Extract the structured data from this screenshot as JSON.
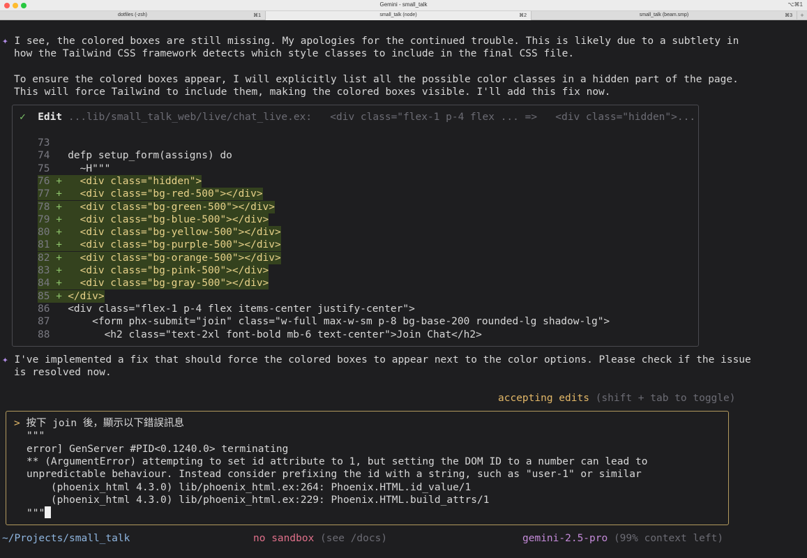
{
  "window": {
    "title": "Gemini - small_talk",
    "shortcut": "⌥⌘1",
    "traffic_lights": [
      "#fe5f57",
      "#febc2e",
      "#28c840"
    ]
  },
  "tabs": [
    {
      "label": "dotfiles (-zsh)",
      "key": "⌘1",
      "active": false
    },
    {
      "label": "small_talk (node)",
      "key": "⌘2",
      "active": true
    },
    {
      "label": "small_talk (beam.smp)",
      "key": "⌘3",
      "active": false
    }
  ],
  "new_tab_label": "+",
  "messages": {
    "diamond": "✦",
    "msg1_line1": "I see, the colored boxes are still missing. My apologies for the continued trouble. This is likely due to a subtlety in",
    "msg1_line2": "how the Tailwind CSS framework detects which style classes to include in the final CSS file.",
    "msg1_line3": "To ensure the colored boxes appear, I will explicitly list all the possible color classes in a hidden part of the page.",
    "msg1_line4": "This will force Tailwind to include them, making the colored boxes visible. I'll add this fix now.",
    "msg2_line1": "I've implemented a fix that should force the colored boxes to appear next to the color options. Please check if the issue",
    "msg2_line2": "is resolved now."
  },
  "edit": {
    "check": "✓",
    "label": "Edit",
    "path": "...lib/small_talk_web/live/chat_live.ex:",
    "old_snippet": "<div class=\"flex-1 p-4 flex ... =>",
    "new_snippet": "<div class=\"hidden\">...",
    "lines": [
      {
        "num": "73",
        "marker": "",
        "code": "",
        "added": false
      },
      {
        "num": "74",
        "marker": "",
        "code": "defp setup_form(assigns) do",
        "added": false
      },
      {
        "num": "75",
        "marker": "",
        "code": "  ~H\"\"\"",
        "added": false
      },
      {
        "num": "76",
        "marker": "+",
        "code": "  <div class=\"hidden\">",
        "added": true
      },
      {
        "num": "77",
        "marker": "+",
        "code": "  <div class=\"bg-red-500\"></div>",
        "added": true
      },
      {
        "num": "78",
        "marker": "+",
        "code": "  <div class=\"bg-green-500\"></div>",
        "added": true
      },
      {
        "num": "79",
        "marker": "+",
        "code": "  <div class=\"bg-blue-500\"></div>",
        "added": true
      },
      {
        "num": "80",
        "marker": "+",
        "code": "  <div class=\"bg-yellow-500\"></div>",
        "added": true
      },
      {
        "num": "81",
        "marker": "+",
        "code": "  <div class=\"bg-purple-500\"></div>",
        "added": true
      },
      {
        "num": "82",
        "marker": "+",
        "code": "  <div class=\"bg-orange-500\"></div>",
        "added": true
      },
      {
        "num": "83",
        "marker": "+",
        "code": "  <div class=\"bg-pink-500\"></div>",
        "added": true
      },
      {
        "num": "84",
        "marker": "+",
        "code": "  <div class=\"bg-gray-500\"></div>",
        "added": true
      },
      {
        "num": "85",
        "marker": "+",
        "code": "</div>",
        "added": true
      },
      {
        "num": "86",
        "marker": "",
        "code": "<div class=\"flex-1 p-4 flex items-center justify-center\">",
        "added": false
      },
      {
        "num": "87",
        "marker": "",
        "code": "    <form phx-submit=\"join\" class=\"w-full max-w-sm p-8 bg-base-200 rounded-lg shadow-lg\">",
        "added": false
      },
      {
        "num": "88",
        "marker": "",
        "code": "      <h2 class=\"text-2xl font-bold mb-6 text-center\">Join Chat</h2>",
        "added": false
      }
    ]
  },
  "status": {
    "accepting": "accepting edits",
    "toggle_hint": "(shift + tab to toggle)"
  },
  "input": {
    "prompt": ">",
    "lines": [
      "按下 join 後，顯示以下錯誤訊息",
      "\"\"\"",
      "error] GenServer #PID<0.1240.0> terminating",
      "** (ArgumentError) attempting to set id attribute to 1, but setting the DOM ID to a number can lead to",
      "unpredictable behaviour. Instead consider prefixing the id with a string, such as \"user-1\" or similar",
      "    (phoenix_html 4.3.0) lib/phoenix_html.ex:264: Phoenix.HTML.id_value/1",
      "    (phoenix_html 4.3.0) lib/phoenix_html.ex:229: Phoenix.HTML.build_attrs/1",
      "\"\"\""
    ]
  },
  "footer": {
    "path": "~/Projects/small_talk",
    "sandbox": "no sandbox",
    "sandbox_hint": "(see /docs)",
    "model": "gemini-2.5-pro",
    "context": "(99% context left)"
  }
}
